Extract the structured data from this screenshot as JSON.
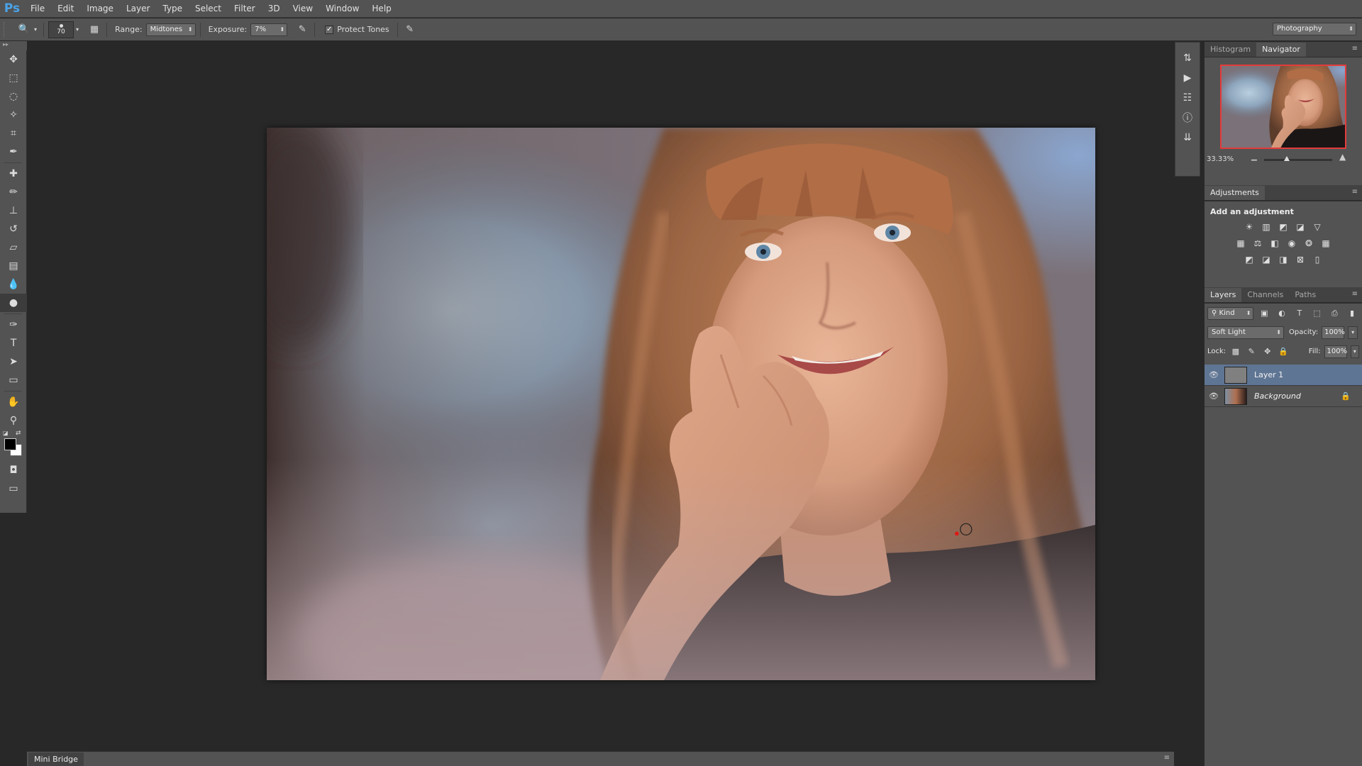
{
  "app": {
    "logo": "Ps"
  },
  "menu": [
    "File",
    "Edit",
    "Image",
    "Layer",
    "Type",
    "Select",
    "Filter",
    "3D",
    "View",
    "Window",
    "Help"
  ],
  "options": {
    "brush_size": "70",
    "range_label": "Range:",
    "range_value": "Midtones",
    "exposure_label": "Exposure:",
    "exposure_value": "7%",
    "protect_tones_label": "Protect Tones",
    "protect_tones_checked": true,
    "workspace": "Photography"
  },
  "panels": {
    "top_tabs": [
      "Histogram",
      "Navigator"
    ],
    "active_top_tab": "Navigator",
    "navigator": {
      "zoom": "33.33%",
      "zoom_slider_level": 0.33
    },
    "adjustments": {
      "tab": "Adjustments",
      "title": "Add an adjustment"
    },
    "layers_tabs": [
      "Layers",
      "Channels",
      "Paths"
    ],
    "layers": {
      "filter_kind": "Kind",
      "blend_mode": "Soft Light",
      "opacity_label": "Opacity:",
      "opacity": "100%",
      "lock_label": "Lock:",
      "fill_label": "Fill:",
      "fill": "100%",
      "items": [
        {
          "name": "Layer 1",
          "selected": true,
          "visible": true,
          "locked": false
        },
        {
          "name": "Background",
          "selected": false,
          "visible": true,
          "locked": true
        }
      ]
    }
  },
  "bottom": {
    "mini_bridge": "Mini Bridge"
  },
  "cursor": {
    "image_x": 0.844,
    "image_y": 0.727
  },
  "colors": {
    "chrome": "#535353",
    "canvas_bg": "#282828",
    "selection": "#5f7594",
    "nav_frame": "#e43b3b",
    "logo": "#4aa3e8"
  }
}
